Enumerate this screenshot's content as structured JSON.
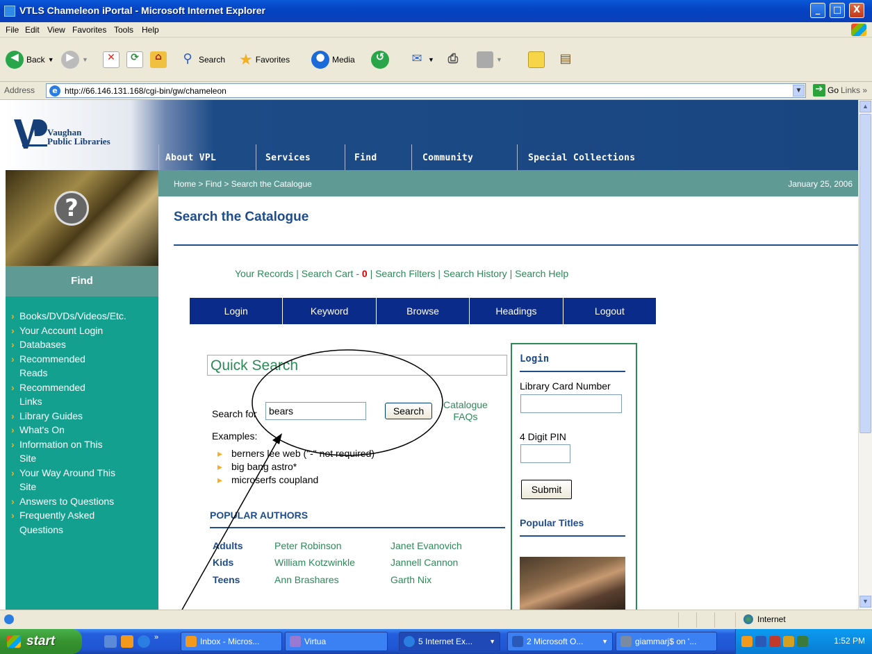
{
  "window": {
    "title": "VTLS Chameleon iPortal - Microsoft Internet Explorer",
    "controls": [
      "_",
      "□",
      "X"
    ]
  },
  "menu": [
    "File",
    "Edit",
    "View",
    "Favorites",
    "Tools",
    "Help"
  ],
  "toolbar": {
    "back": "Back",
    "search": "Search",
    "favorites": "Favorites",
    "media": "Media"
  },
  "address": {
    "label": "Address",
    "url": "http://66.146.131.168/cgi-bin/gw/chameleon",
    "go": "Go",
    "links": "Links"
  },
  "site": {
    "logo_line1": "Vaughan",
    "logo_line2": "Public Libraries",
    "nav": [
      "About VPL",
      "Services",
      "Find",
      "Community",
      "Special Collections"
    ],
    "breadcrumb": "Home > Find > Search the Catalogue",
    "date": "January 25, 2006",
    "sidebar_title": "Find",
    "sidebar_items": [
      "Books/DVDs/Videos/Etc.",
      "Your Account Login",
      "Databases",
      "Recommended Reads",
      "Recommended Links",
      "Library Guides",
      "What's On",
      "Information on This Site",
      "Your Way Around This Site",
      "Answers to Questions",
      "Frequently Asked Questions"
    ],
    "page_title": "Search the Catalogue",
    "links": {
      "records": "Your Records",
      "cart": "Search Cart -",
      "cart_count": "0",
      "filters": "Search Filters",
      "history": "Search History",
      "help": "Search Help",
      "sep": "|"
    },
    "catalogue_nav": [
      "Login",
      "Keyword",
      "Browse",
      "Headings",
      "Logout"
    ],
    "quick_search": {
      "title": "Quick Search",
      "label": "Search for",
      "value": "bears",
      "button": "Search",
      "faq_line1": "Catalogue",
      "faq_line2": "FAQs",
      "examples_label": "Examples:",
      "examples": [
        "berners lee web (\"-\" not required)",
        "big bang astro*",
        "microserfs coupland"
      ]
    },
    "popular_authors": {
      "title": "POPULAR AUTHORS",
      "rows": [
        {
          "category": "Adults",
          "a1": "Peter Robinson",
          "a2": "Janet Evanovich"
        },
        {
          "category": "Kids",
          "a1": "William Kotzwinkle",
          "a2": "Jannell Cannon"
        },
        {
          "category": "Teens",
          "a1": "Ann Brashares",
          "a2": "Garth Nix"
        }
      ]
    },
    "login_panel": {
      "title": "Login",
      "card_label": "Library Card Number",
      "pin_label": "4 Digit PIN",
      "submit": "Submit",
      "popular_titles": "Popular Titles"
    }
  },
  "status": {
    "zone": "Internet"
  },
  "taskbar": {
    "start": "start",
    "tasks": [
      "Inbox - Micros...",
      "Virtua",
      "5 Internet Ex...",
      "2 Microsoft O...",
      "giammarj$ on '..."
    ],
    "clock": "1:52 PM"
  },
  "colors": {
    "header_blue": "#1a4680",
    "teal_sidebar": "#14a08e",
    "breadcrumb_bar": "#5f9a95",
    "catalogue_nav": "#0b2b8a",
    "link_green": "#2c8a57"
  }
}
